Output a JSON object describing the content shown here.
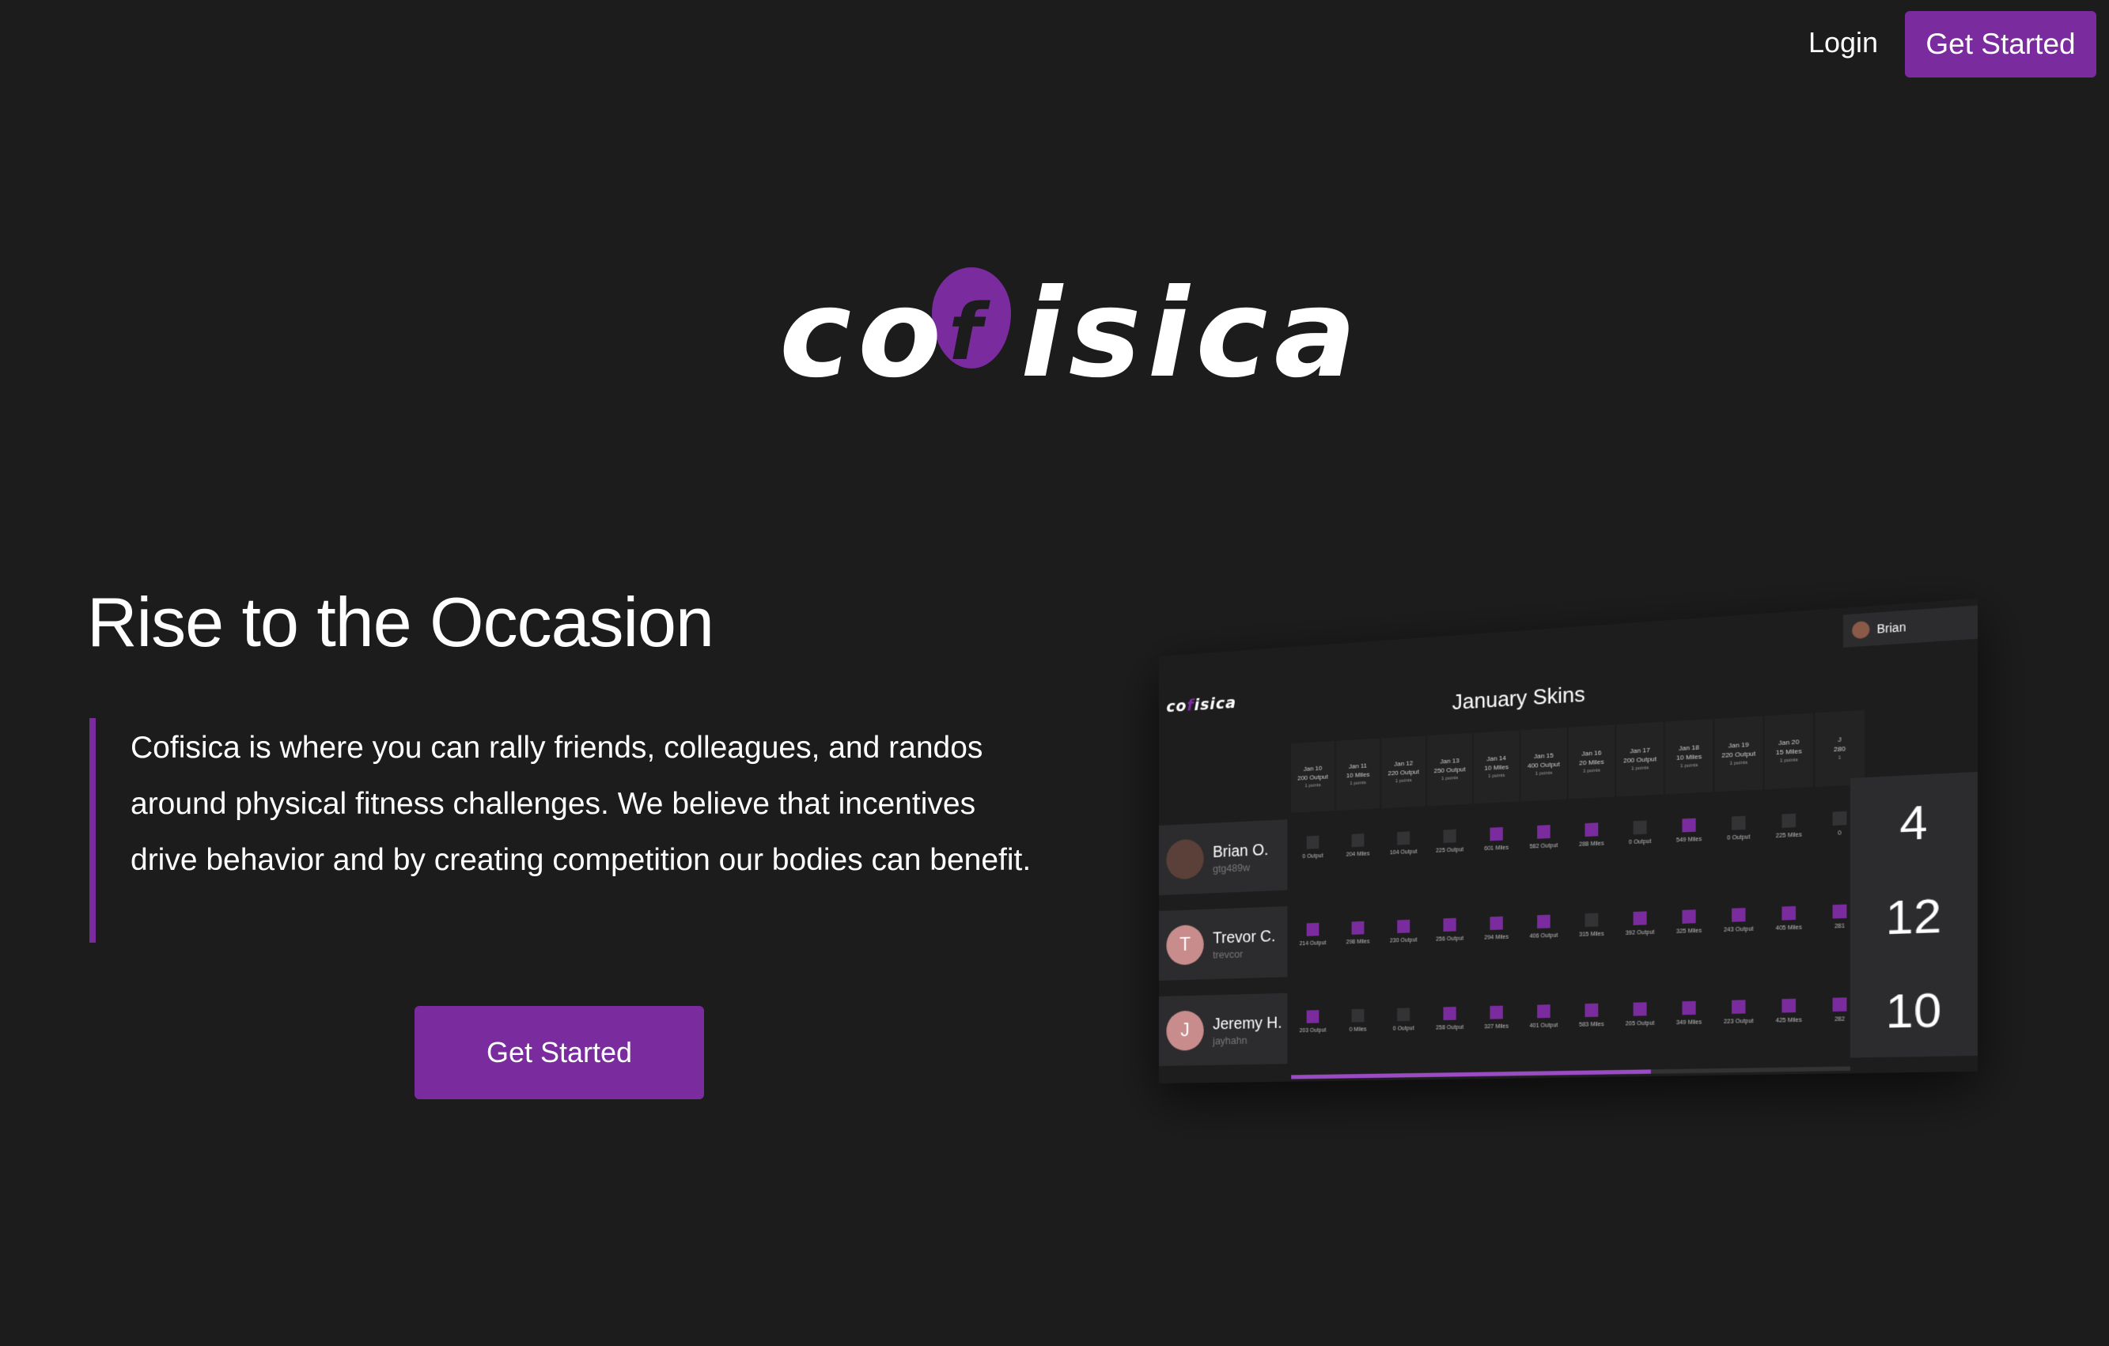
{
  "nav": {
    "login_label": "Login",
    "cta_label": "Get Started"
  },
  "brand": {
    "logo_text_left": "co",
    "logo_letter_f": "f",
    "logo_text_right": "isica",
    "accent_color": "#7a2b9e",
    "background_color": "#1c1c1d"
  },
  "hero": {
    "title": "Rise to the Occasion",
    "body": "Cofisica is where you can rally friends, colleagues, and randos around physical fitness challenges. We believe that incentives drive behavior and by creating competition our bodies can benefit.",
    "cta_label": "Get Started"
  },
  "preview": {
    "logo_left": "co",
    "logo_f": "f",
    "logo_right": "isica",
    "user_name": "Brian",
    "title": "January Skins",
    "columns": [
      {
        "date": "Jan 10",
        "goal": "200 Output",
        "points": "1 points"
      },
      {
        "date": "Jan 11",
        "goal": "10 Miles",
        "points": "1 points"
      },
      {
        "date": "Jan 12",
        "goal": "220 Output",
        "points": "1 points"
      },
      {
        "date": "Jan 13",
        "goal": "250 Output",
        "points": "1 points"
      },
      {
        "date": "Jan 14",
        "goal": "10 Miles",
        "points": "1 points"
      },
      {
        "date": "Jan 15",
        "goal": "400 Output",
        "points": "1 points"
      },
      {
        "date": "Jan 16",
        "goal": "20 Miles",
        "points": "1 points"
      },
      {
        "date": "Jan 17",
        "goal": "200 Output",
        "points": "1 points"
      },
      {
        "date": "Jan 18",
        "goal": "10 Miles",
        "points": "1 points"
      },
      {
        "date": "Jan 19",
        "goal": "220 Output",
        "points": "1 points"
      },
      {
        "date": "Jan 20",
        "goal": "15 Miles",
        "points": "1 points"
      },
      {
        "date": "J",
        "goal": "280",
        "points": "1"
      }
    ],
    "participants": [
      {
        "name": "Brian O.",
        "handle": "gtg489w",
        "initial": "",
        "score": "4",
        "cells": [
          {
            "label": "0 Output",
            "on": false
          },
          {
            "label": "204 Miles",
            "on": false
          },
          {
            "label": "104 Output",
            "on": false
          },
          {
            "label": "225 Output",
            "on": false
          },
          {
            "label": "601 Miles",
            "on": true
          },
          {
            "label": "582 Output",
            "on": true
          },
          {
            "label": "288 Miles",
            "on": true
          },
          {
            "label": "0 Output",
            "on": false
          },
          {
            "label": "549 Miles",
            "on": true
          },
          {
            "label": "0 Output",
            "on": false
          },
          {
            "label": "225 Miles",
            "on": false
          },
          {
            "label": "0",
            "on": false
          }
        ]
      },
      {
        "name": "Trevor C.",
        "handle": "trevcor",
        "initial": "T",
        "score": "12",
        "cells": [
          {
            "label": "214 Output",
            "on": true
          },
          {
            "label": "298 Miles",
            "on": true
          },
          {
            "label": "230 Output",
            "on": true
          },
          {
            "label": "256 Output",
            "on": true
          },
          {
            "label": "294 Miles",
            "on": true
          },
          {
            "label": "406 Output",
            "on": true
          },
          {
            "label": "315 Miles",
            "on": false
          },
          {
            "label": "392 Output",
            "on": true
          },
          {
            "label": "325 Miles",
            "on": true
          },
          {
            "label": "243 Output",
            "on": true
          },
          {
            "label": "405 Miles",
            "on": true
          },
          {
            "label": "281",
            "on": true
          }
        ]
      },
      {
        "name": "Jeremy H.",
        "handle": "jayhahn",
        "initial": "J",
        "score": "10",
        "cells": [
          {
            "label": "203 Output",
            "on": true
          },
          {
            "label": "0 Miles",
            "on": false
          },
          {
            "label": "0 Output",
            "on": false
          },
          {
            "label": "258 Output",
            "on": true
          },
          {
            "label": "327 Miles",
            "on": true
          },
          {
            "label": "401 Output",
            "on": true
          },
          {
            "label": "583 Miles",
            "on": true
          },
          {
            "label": "205 Output",
            "on": true
          },
          {
            "label": "349 Miles",
            "on": true
          },
          {
            "label": "223 Output",
            "on": true
          },
          {
            "label": "425 Miles",
            "on": true
          },
          {
            "label": "282",
            "on": true
          }
        ]
      }
    ],
    "progress_fraction": 0.66
  }
}
